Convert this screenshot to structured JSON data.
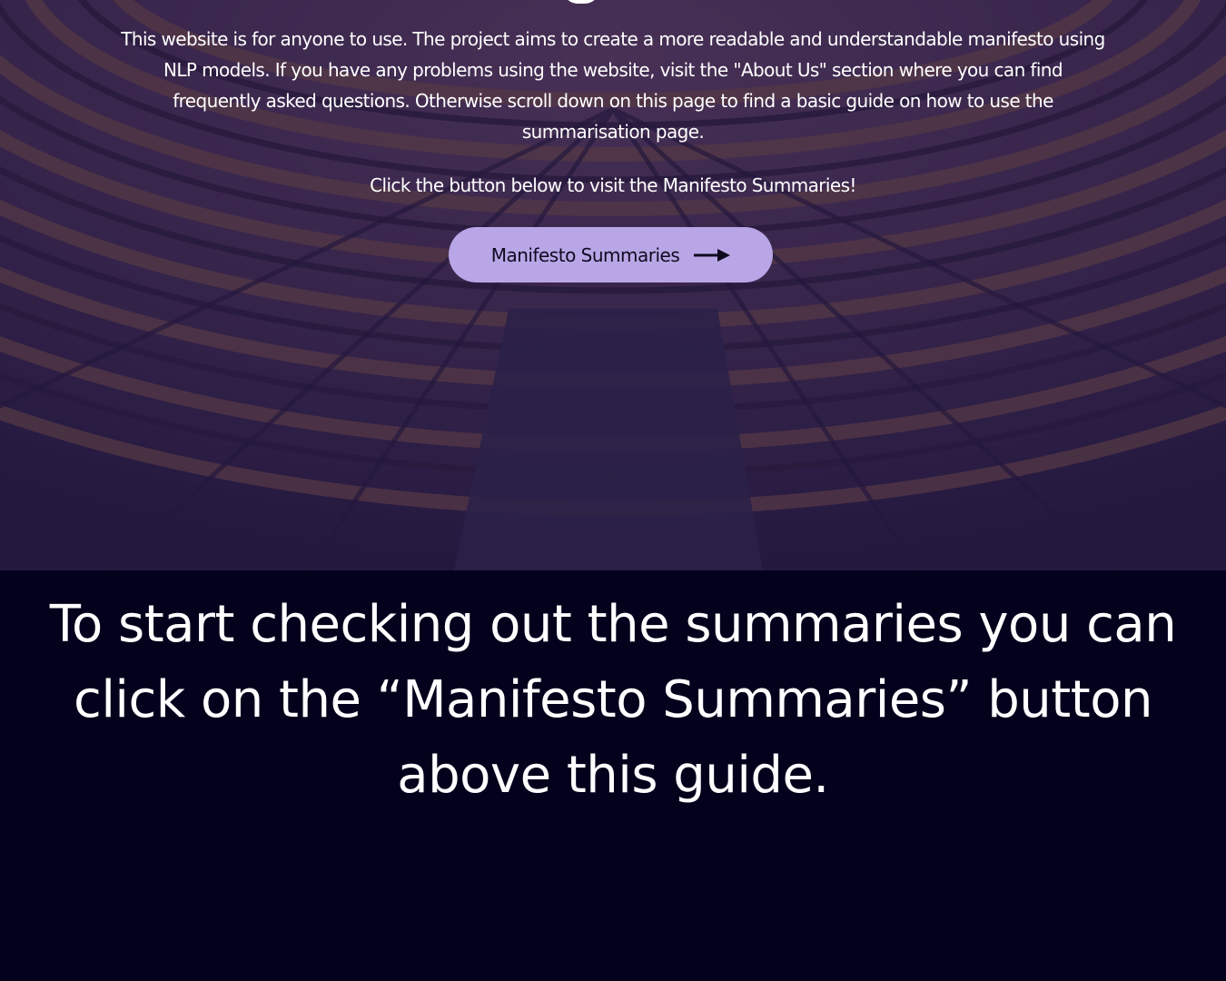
{
  "hero": {
    "background": "parliament-chamber-seats",
    "intro_text": "This website is for anyone to use. The project aims to create a more readable and understandable manifesto using NLP models. If you have any problems using the website, visit the \"About Us\" section where you can find frequently asked questions. Otherwise scroll down on this page to find a basic guide on how to use the summarisation page.",
    "cta_text": "Click the button below to visit the Manifesto Summaries!",
    "button": {
      "label": "Manifesto Summaries",
      "icon": "arrow-right-icon",
      "color": "#b9a6e6"
    }
  },
  "guide": {
    "text": "To start checking out the summaries you can click on the “Manifesto Summaries” button above this guide.",
    "background": "#04011c"
  }
}
